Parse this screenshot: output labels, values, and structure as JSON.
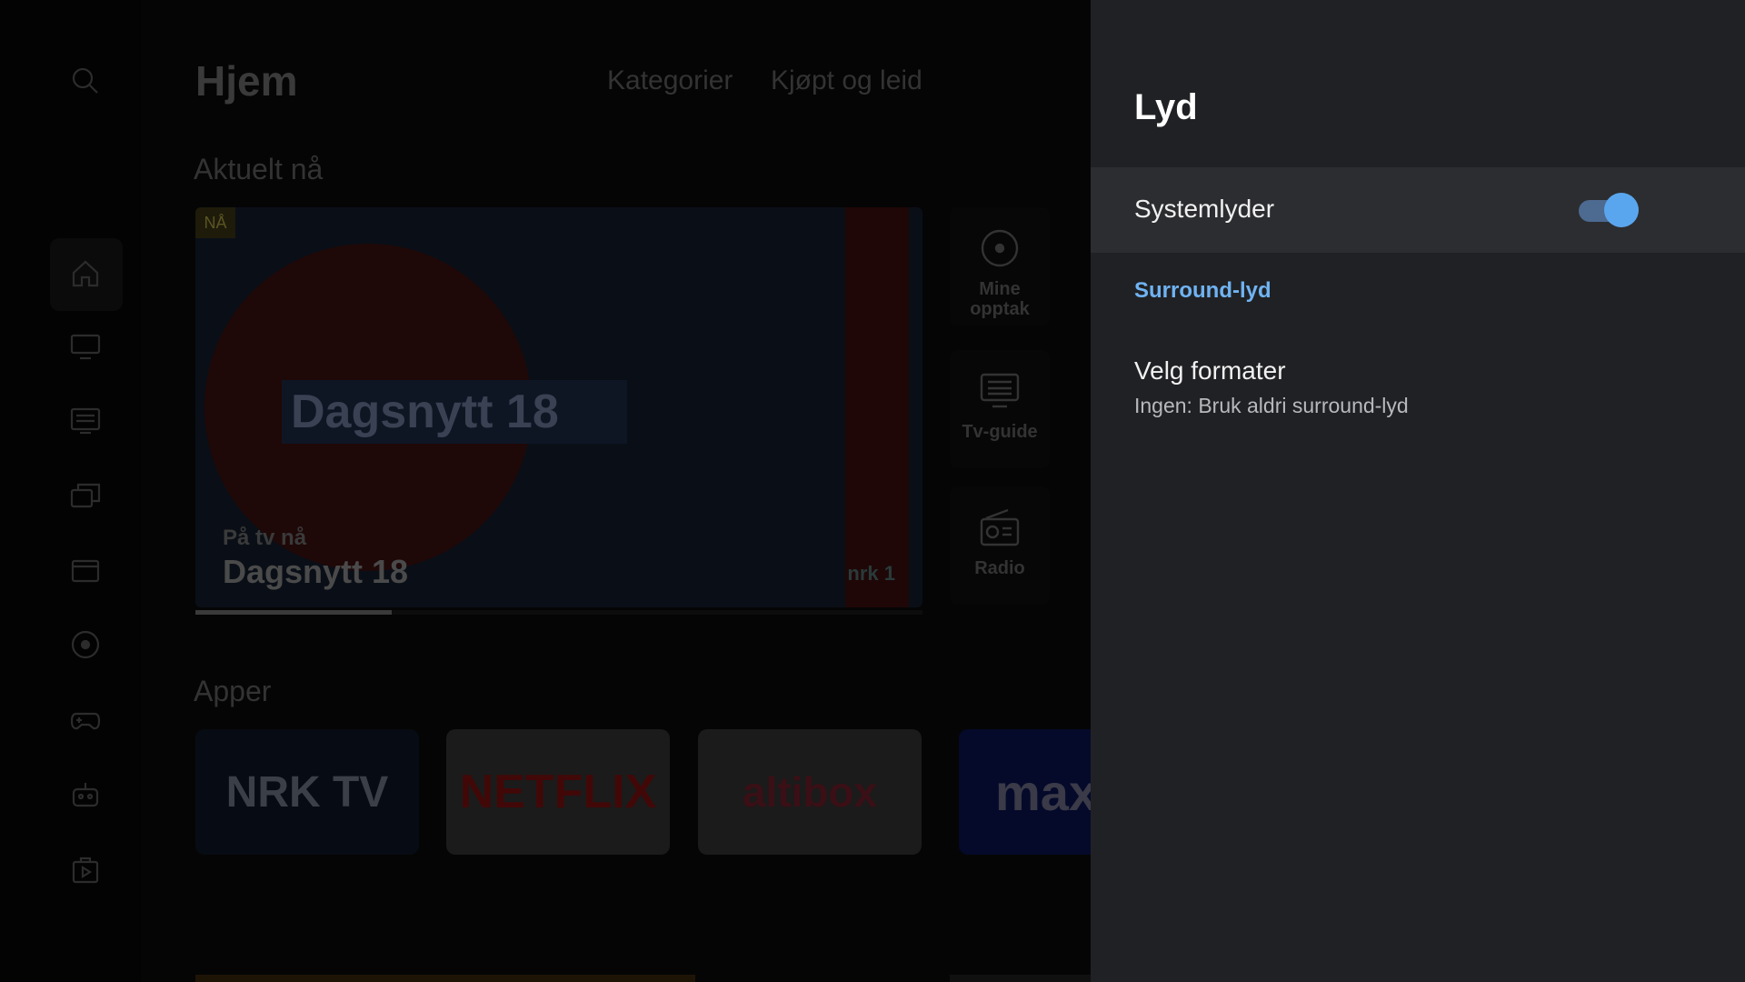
{
  "home": {
    "title": "Hjem",
    "tabs": [
      "Kategorier",
      "Kjøpt og leid"
    ],
    "section_now": "Aktuelt nå",
    "hero": {
      "badge": "NÅ",
      "big_text": "Dagsnytt 18",
      "subtitle": "På tv nå",
      "program": "Dagsnytt 18",
      "channel_logo": "nrk 1",
      "progress_percent": 27
    },
    "shortcuts": [
      {
        "label": "Mine opptak",
        "icon": "record-icon"
      },
      {
        "label": "Tv-guide",
        "icon": "tv-guide-icon"
      },
      {
        "label": "Radio",
        "icon": "radio-icon"
      }
    ],
    "section_apps": "Apper",
    "apps": [
      "NRK TV",
      "NETFLIX",
      "altibox",
      "max"
    ],
    "rail_icons": [
      "search-icon",
      "home-icon",
      "tv-icon",
      "guide-icon",
      "library-icon",
      "movie-icon",
      "record-icon",
      "gamepad-icon",
      "robot-icon",
      "play-store-icon"
    ]
  },
  "panel": {
    "title": "Lyd",
    "system_sounds": {
      "label": "Systemlyder",
      "enabled": true
    },
    "surround_header": "Surround-lyd",
    "format": {
      "label": "Velg formater",
      "value": "Ingen: Bruk aldri surround-lyd"
    }
  },
  "colors": {
    "panel_bg": "#202124",
    "selected_row_bg": "#2c2d30",
    "accent": "#6fb3f2",
    "toggle_knob": "#5aa6ee",
    "toggle_track": "#4d6a91"
  }
}
